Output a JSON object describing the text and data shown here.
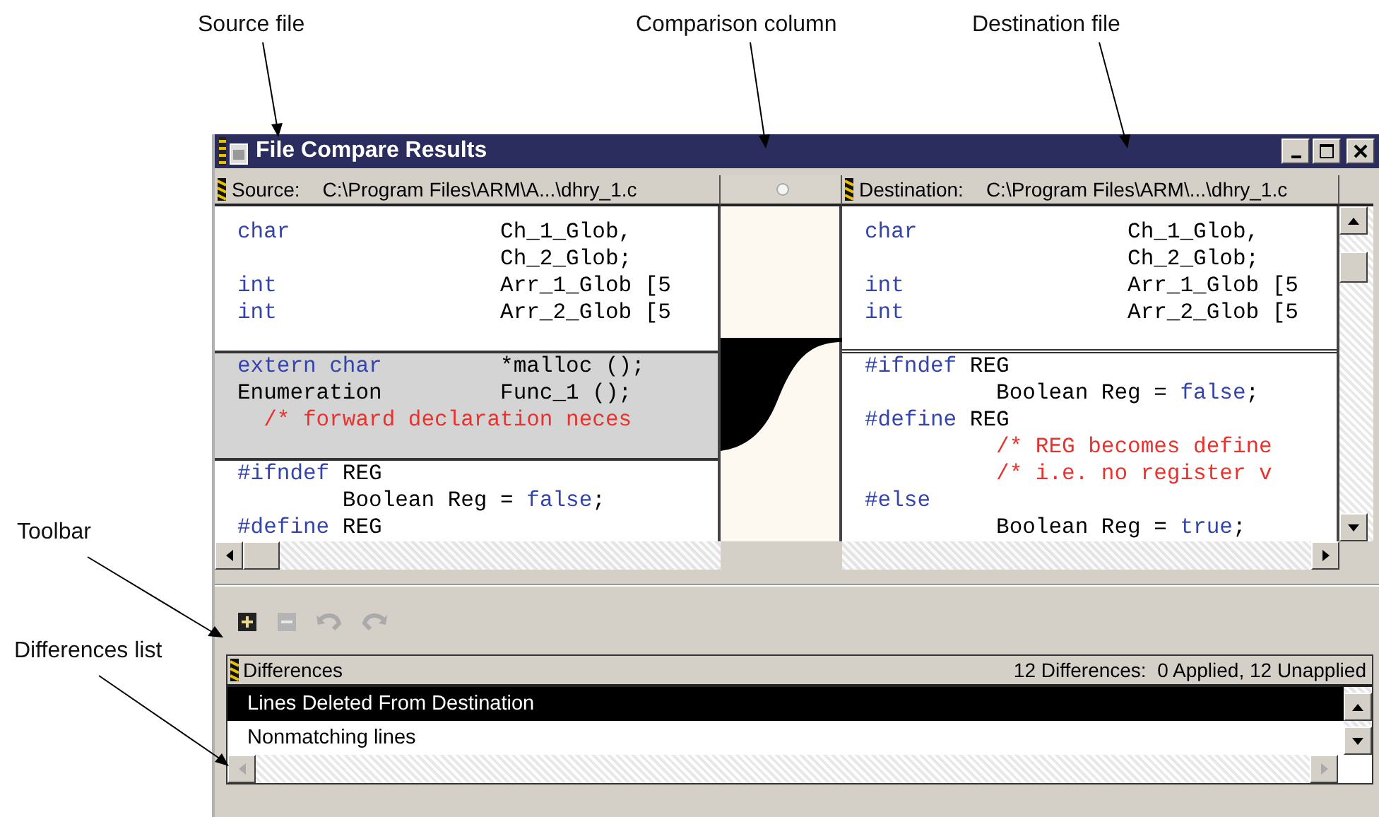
{
  "callouts": {
    "top": [
      "Source file",
      "Comparison column",
      "Destination file"
    ],
    "side": [
      "Toolbar",
      "Differences list"
    ]
  },
  "window": {
    "title": "File Compare Results"
  },
  "source_pane": {
    "label": "Source:",
    "path": "C:\\Program Files\\ARM\\A...\\dhry_1.c",
    "blocks": [
      {
        "highlighted": false,
        "divider_above": false,
        "lines": [
          [
            {
              "kind": "keyword",
              "text": "char"
            },
            {
              "kind": "plain",
              "text": "                Ch_1_Glob,"
            }
          ],
          [
            {
              "kind": "plain",
              "text": "                    Ch_2_Glob;"
            }
          ],
          [
            {
              "kind": "keyword",
              "text": "int"
            },
            {
              "kind": "plain",
              "text": "                 Arr_1_Glob [5"
            }
          ],
          [
            {
              "kind": "keyword",
              "text": "int"
            },
            {
              "kind": "plain",
              "text": "                 Arr_2_Glob [5"
            }
          ]
        ]
      },
      {
        "highlighted": true,
        "divider_above": false,
        "lines": [
          [
            {
              "kind": "keyword",
              "text": "extern char"
            },
            {
              "kind": "plain",
              "text": "         *malloc ();"
            }
          ],
          [
            {
              "kind": "plain",
              "text": "Enumeration         Func_1 ();"
            }
          ],
          [
            {
              "kind": "comment",
              "text": "  /* forward declaration neces"
            }
          ]
        ]
      },
      {
        "highlighted": false,
        "divider_above": false,
        "lines": [
          [
            {
              "kind": "keyword",
              "text": "#ifndef"
            },
            {
              "kind": "plain",
              "text": " REG"
            }
          ],
          [
            {
              "kind": "plain",
              "text": "        Boolean Reg = "
            },
            {
              "kind": "keyword",
              "text": "false"
            },
            {
              "kind": "plain",
              "text": ";"
            }
          ],
          [
            {
              "kind": "keyword",
              "text": "#define"
            },
            {
              "kind": "plain",
              "text": " REG"
            }
          ]
        ]
      }
    ]
  },
  "destination_pane": {
    "label": "Destination:",
    "path": "C:\\Program Files\\ARM\\...\\dhry_1.c",
    "blocks": [
      {
        "highlighted": false,
        "divider_above": false,
        "lines": [
          [
            {
              "kind": "keyword",
              "text": "char"
            },
            {
              "kind": "plain",
              "text": "                Ch_1_Glob,"
            }
          ],
          [
            {
              "kind": "plain",
              "text": "                    Ch_2_Glob;"
            }
          ],
          [
            {
              "kind": "keyword",
              "text": "int"
            },
            {
              "kind": "plain",
              "text": "                 Arr_1_Glob [5"
            }
          ],
          [
            {
              "kind": "keyword",
              "text": "int"
            },
            {
              "kind": "plain",
              "text": "                 Arr_2_Glob [5"
            }
          ]
        ]
      },
      {
        "highlighted": false,
        "divider_above": true,
        "lines": [
          [
            {
              "kind": "keyword",
              "text": "#ifndef"
            },
            {
              "kind": "plain",
              "text": " REG"
            }
          ],
          [
            {
              "kind": "plain",
              "text": "          Boolean Reg = "
            },
            {
              "kind": "keyword",
              "text": "false"
            },
            {
              "kind": "plain",
              "text": ";"
            }
          ],
          [
            {
              "kind": "keyword",
              "text": "#define"
            },
            {
              "kind": "plain",
              "text": " REG"
            }
          ],
          [
            {
              "kind": "comment",
              "text": "          /* REG becomes define"
            }
          ],
          [
            {
              "kind": "comment",
              "text": "          /* i.e. no register v"
            }
          ],
          [
            {
              "kind": "keyword",
              "text": "#else"
            }
          ],
          [
            {
              "kind": "plain",
              "text": "          Boolean Reg = "
            },
            {
              "kind": "keyword",
              "text": "true"
            },
            {
              "kind": "plain",
              "text": ";"
            }
          ]
        ]
      }
    ]
  },
  "toolbar": [
    {
      "kind": "plus",
      "disabled": false
    },
    {
      "kind": "minus",
      "disabled": true
    },
    {
      "kind": "undo",
      "disabled": true
    },
    {
      "kind": "redo",
      "disabled": true
    }
  ],
  "differences": {
    "title": "Differences",
    "summary": "12 Differences:  0 Applied, 12 Unapplied",
    "items": [
      {
        "text": "Lines Deleted From Destination",
        "selected": true
      },
      {
        "text": "Nonmatching lines",
        "selected": false
      }
    ]
  }
}
